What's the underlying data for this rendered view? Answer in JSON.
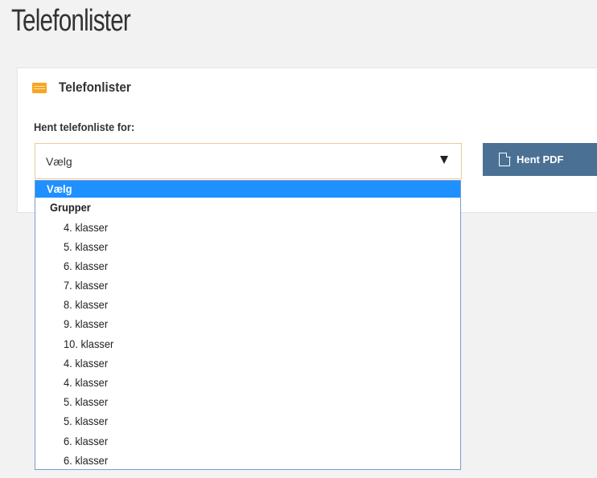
{
  "page": {
    "title": "Telefonlister"
  },
  "panel": {
    "title": "Telefonlister",
    "icon": "list-icon",
    "field_label": "Hent telefonliste for:"
  },
  "select": {
    "value": "Vælg",
    "arrow_icon": "triangle-down-icon"
  },
  "button": {
    "label": "Hent PDF",
    "icon": "pdf-file-icon",
    "color": "#4a7194"
  },
  "dropdown": {
    "selected_label": "Vælg",
    "selected_color": "#1e90ff",
    "group_label": "Grupper",
    "options": [
      "4. klasser",
      "5. klasser",
      "6. klasser",
      "7. klasser",
      "8. klasser",
      "9. klasser",
      "10. klasser",
      "4. klasser",
      "4. klasser",
      "5. klasser",
      "5. klasser",
      "6. klasser",
      "6. klasser"
    ]
  }
}
